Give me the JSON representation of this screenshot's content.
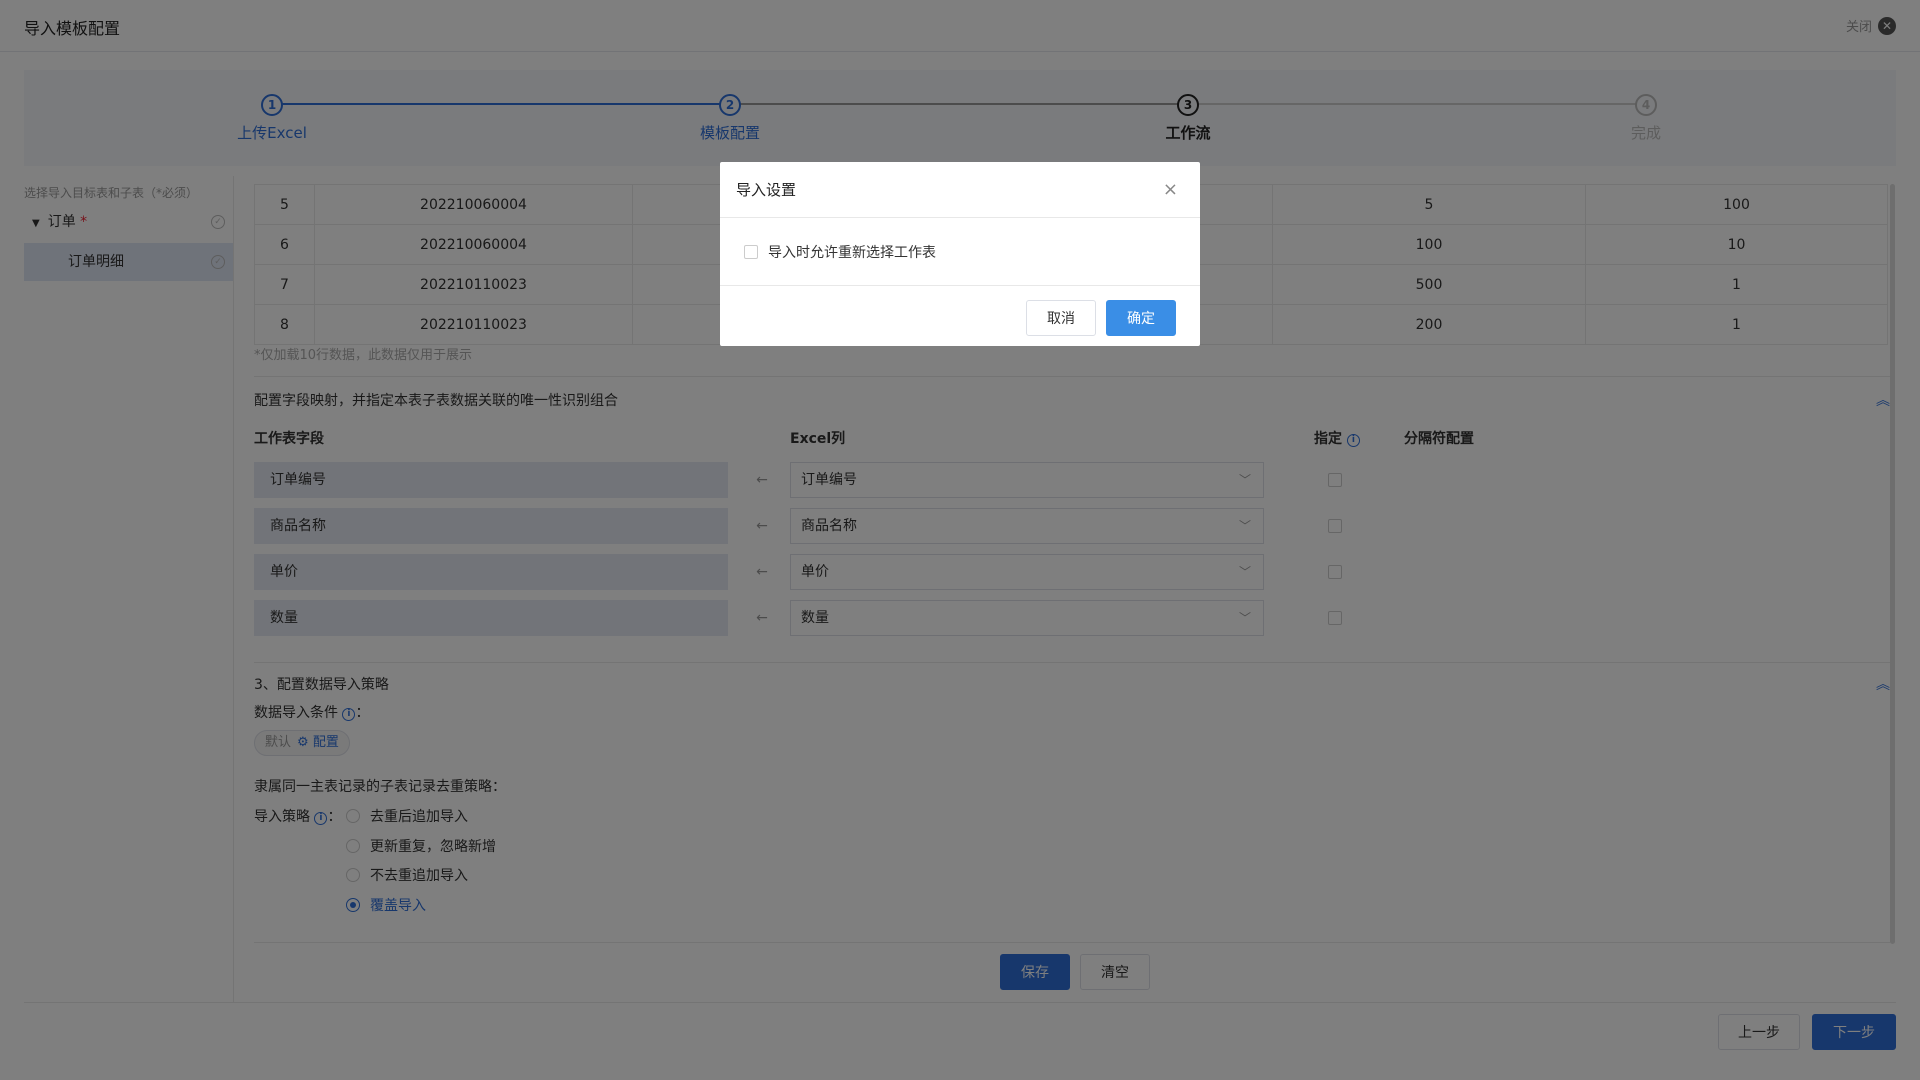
{
  "header": {
    "title": "导入模板配置",
    "close_label": "关闭"
  },
  "steps": [
    {
      "num": "1",
      "label": "上传Excel",
      "state": "done"
    },
    {
      "num": "2",
      "label": "模板配置",
      "state": "done"
    },
    {
      "num": "3",
      "label": "工作流",
      "state": "active"
    },
    {
      "num": "4",
      "label": "完成",
      "state": "todo"
    }
  ],
  "left": {
    "hint": "选择导入目标表和子表（*必须）",
    "root_label": "订单",
    "root_required": "*",
    "child_label": "订单明细"
  },
  "preview": {
    "rows": [
      [
        "5",
        "202210060004",
        "",
        "",
        "5",
        "100"
      ],
      [
        "6",
        "202210060004",
        "",
        "",
        "100",
        "10"
      ],
      [
        "7",
        "202210110023",
        "",
        "",
        "500",
        "1"
      ],
      [
        "8",
        "202210110023",
        "",
        "",
        "200",
        "1"
      ]
    ],
    "note": "*仅加载10行数据，此数据仅用于展示"
  },
  "mapping": {
    "title": "配置字段映射，并指定本表子表数据关联的唯一性识别组合",
    "col_worksheet": "工作表字段",
    "col_excel": "Excel列",
    "col_assign": "指定",
    "col_separator": "分隔符配置",
    "rows": [
      {
        "field": "订单编号",
        "excel": "订单编号"
      },
      {
        "field": "商品名称",
        "excel": "商品名称"
      },
      {
        "field": "单价",
        "excel": "单价"
      },
      {
        "field": "数量",
        "excel": "数量"
      }
    ]
  },
  "strategy": {
    "title": "3、配置数据导入策略",
    "condition_label": "数据导入条件",
    "condition_colon": "：",
    "condition_default": "默认",
    "condition_config": "配置",
    "dedupe_label": "隶属同一主表记录的子表记录去重策略：",
    "policy_label": "导入策略",
    "policy_colon": "：",
    "options": [
      {
        "label": "去重后追加导入",
        "selected": false
      },
      {
        "label": "更新重复，忽略新增",
        "selected": false
      },
      {
        "label": "不去重追加导入",
        "selected": false
      },
      {
        "label": "覆盖导入",
        "selected": true
      }
    ]
  },
  "actions": {
    "save": "保存",
    "clear": "清空",
    "prev": "上一步",
    "next": "下一步"
  },
  "dialog": {
    "title": "导入设置",
    "checkbox_label": "导入时允许重新选择工作表",
    "cancel": "取消",
    "ok": "确定"
  },
  "colors": {
    "primary": "#2f6fd8",
    "primary_dialog": "#3a8ee6"
  }
}
